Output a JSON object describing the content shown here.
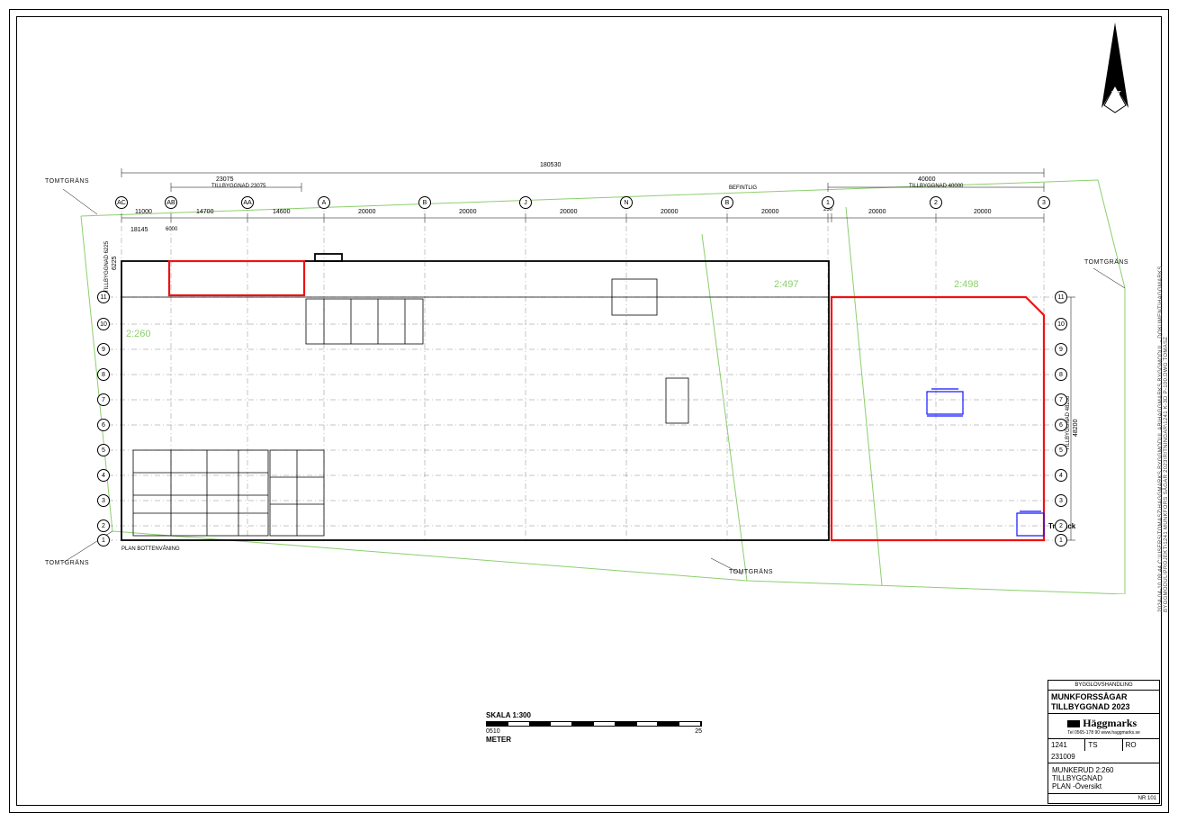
{
  "tomtgrans_label": "TOMTGRÄNS",
  "befintlig": "BEFINTLIG",
  "dimensions": {
    "total_length": "180530",
    "left_ext": "23075",
    "left_ext_label": "TILLBYGGNAD 23075",
    "right_ext": "40000",
    "right_ext_label": "TILLBYGGNAD 40000",
    "seg_11000": "11000",
    "seg_14700": "14700",
    "seg_14600": "14600",
    "seg_20000": "20000",
    "seg_230": "230",
    "left_height": "6225",
    "left_height_label": "TILLBYGGNAD 6225",
    "seg_18145": "18145",
    "seg_6000": "6000",
    "right_height_label": "TILLBYGGNAD 48200",
    "right_height": "48200"
  },
  "lots": {
    "l260": "2:260",
    "l497": "2:497",
    "l498": "2:498"
  },
  "grid_cols": [
    "AC",
    "AB",
    "AA",
    "A",
    "B",
    "J",
    "N",
    "B",
    "1",
    "2",
    "3"
  ],
  "grid_rows_left": [
    "11",
    "10",
    "9",
    "8",
    "7",
    "6",
    "5",
    "4",
    "3",
    "2",
    "1"
  ],
  "grid_rows_right": [
    "11",
    "10",
    "9",
    "8",
    "7",
    "6",
    "5",
    "4",
    "3",
    "2",
    "1"
  ],
  "tradack": "Trädäck",
  "plan_bottom_label": "PLAN BOTTENVÅNING",
  "scale": {
    "title": "SKALA 1:300",
    "ticks": [
      "0",
      "5",
      "10",
      "25"
    ],
    "unit": "METER"
  },
  "titleblock": {
    "handling": "BYGGLOVSHANDLING",
    "project1": "MUNKFORSSÅGAR",
    "project2": "TILLBYGGNAD 2023",
    "logo": "Häggmarks",
    "logo_sub": "Tel 0565-178 90   www.haggmarks.se",
    "num": "1241",
    "by1": "TS",
    "by2": "RO",
    "date": "231009",
    "obj1": "MUNKERUD 2:260",
    "obj2": "TILLBYGGNAD",
    "obj3": "PLAN -Översikt",
    "nr": "NR 101"
  },
  "sidetext": "2024-04-10 09:44   C:\\USERS\\TOMASZ\\HÄGGMARKS BYGGMODUL AB\\HÄGGMARKS BYGGMODUL - DOKUMENT\\HÄGGMARKS BYGGMODUL\\PROJEKT\\1241 MUNKFORS SÅGAR 2023\\RITNINGAR\\1241 K-3D P-100.DWG   TOMASZ"
}
